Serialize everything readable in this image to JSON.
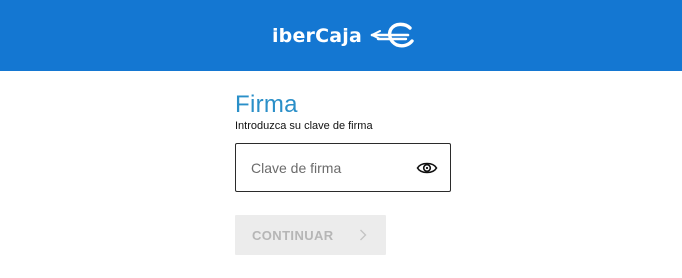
{
  "header": {
    "brand_name": "iberCaja",
    "logo_icon": "ibercaja-euro-logo",
    "background": "#1477d2"
  },
  "form": {
    "title": "Firma",
    "subtitle": "Introduzca su clave de firma",
    "password": {
      "placeholder": "Clave de firma",
      "value": "",
      "toggle_icon": "eye-icon"
    },
    "continue_button": {
      "label": "CONTINUAR",
      "icon": "chevron-right-icon",
      "state": "disabled"
    }
  },
  "colors": {
    "accent": "#2a8fc8",
    "button_disabled_bg": "#ececec",
    "button_disabled_text": "#b6b6b6"
  }
}
